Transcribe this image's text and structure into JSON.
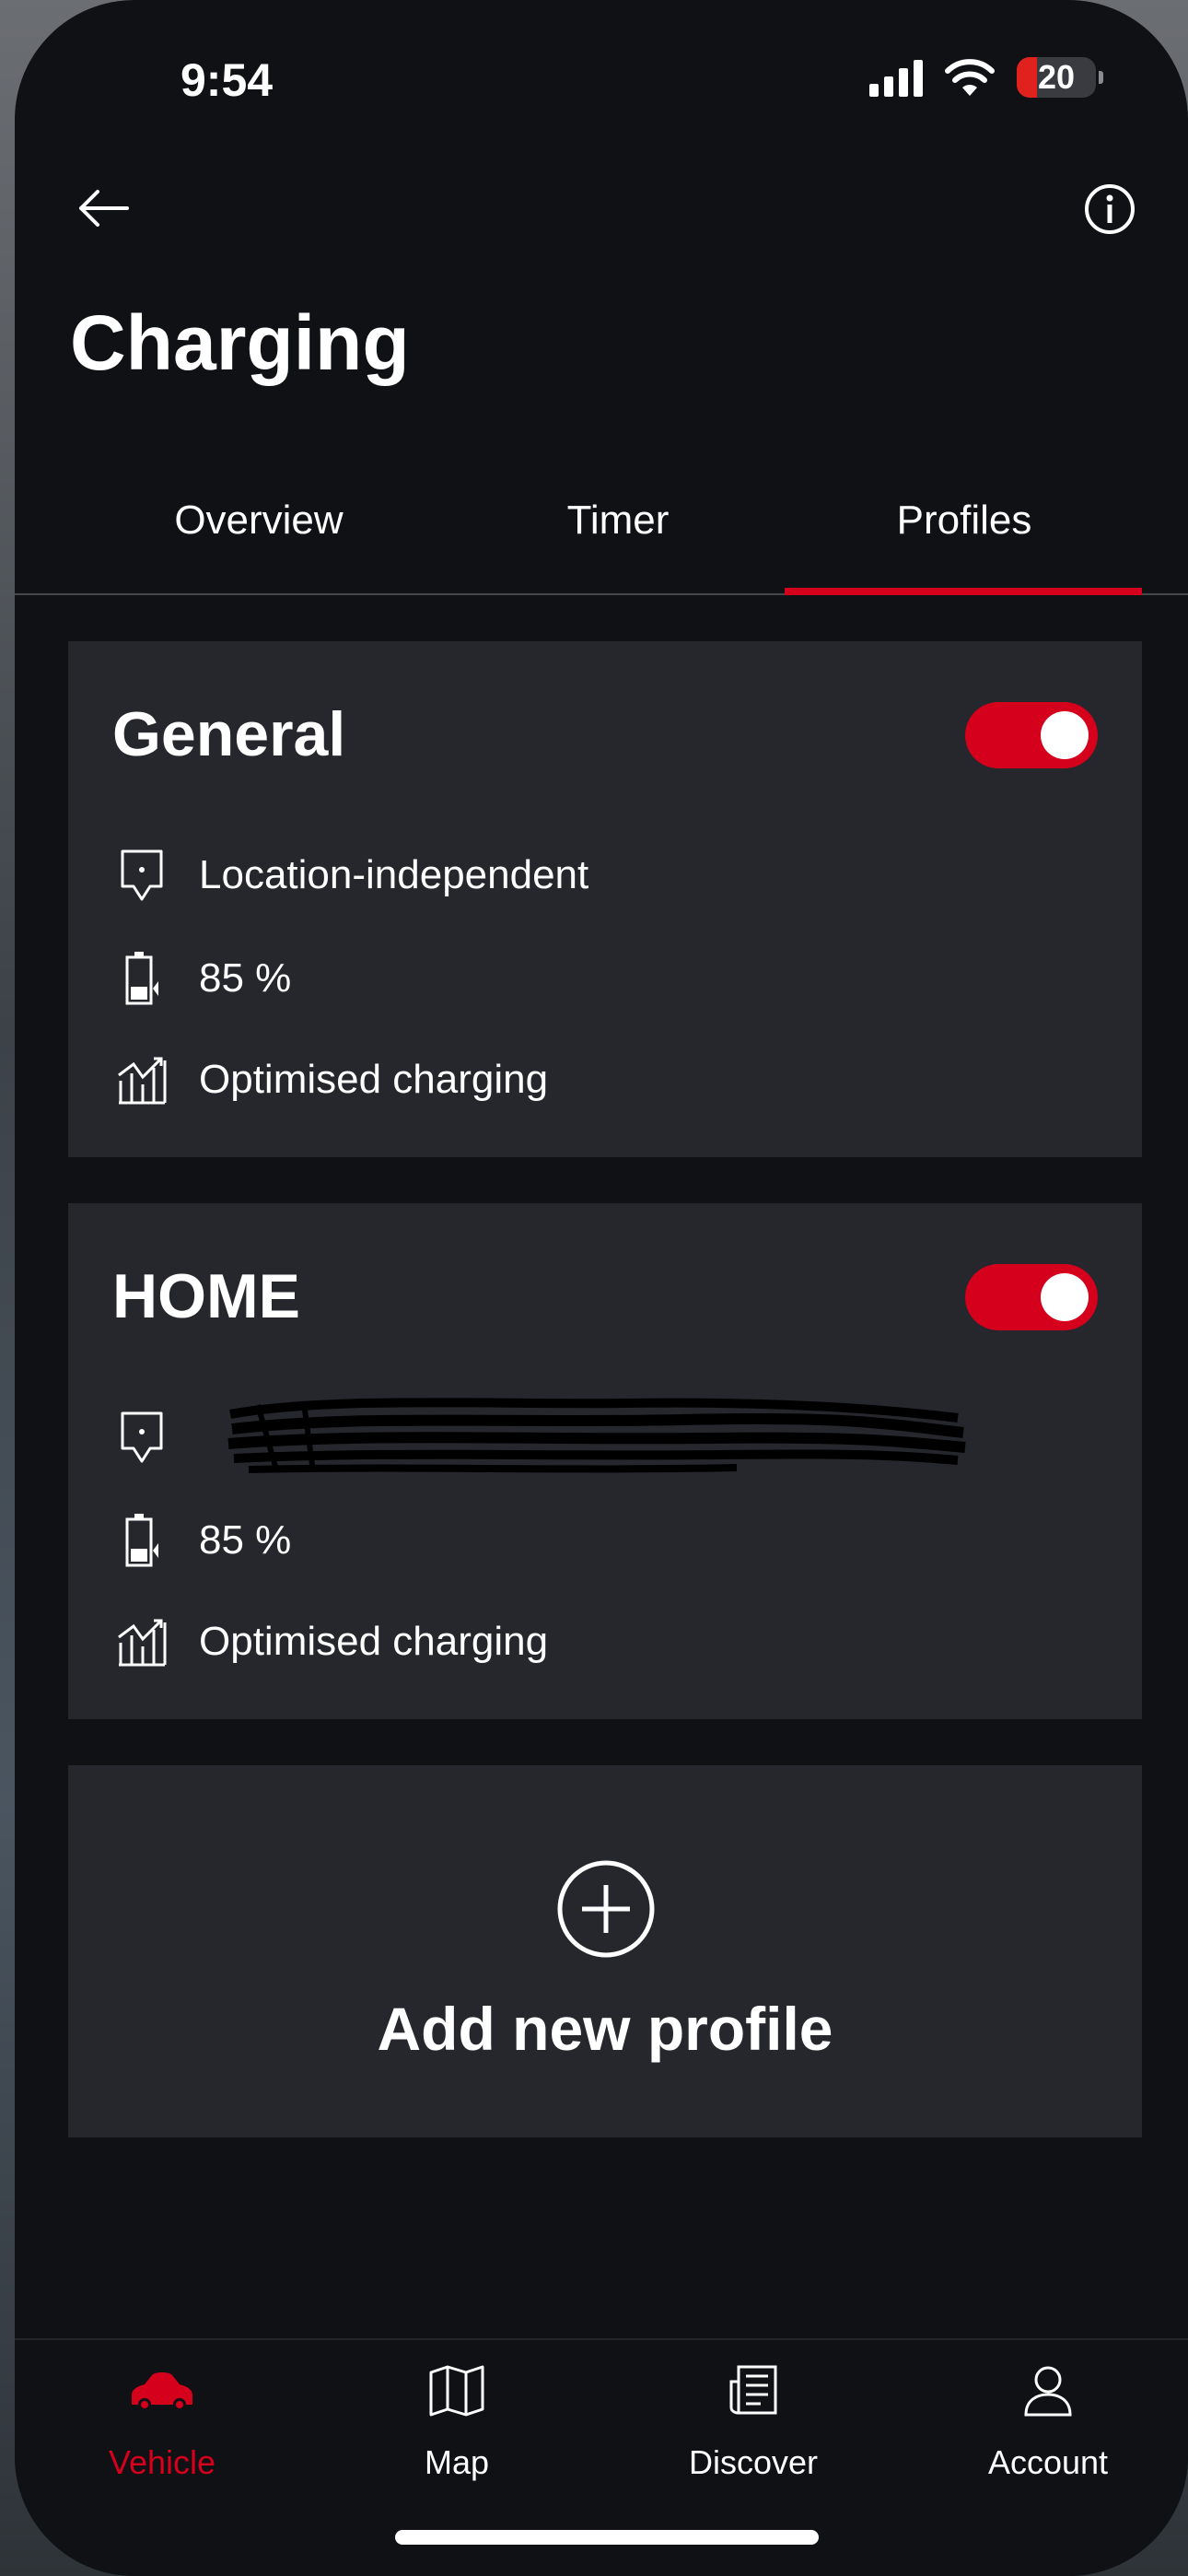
{
  "status_bar": {
    "time": "9:54",
    "battery_level": "20"
  },
  "header": {
    "title": "Charging"
  },
  "tabs": [
    {
      "label": "Overview",
      "active": false
    },
    {
      "label": "Timer",
      "active": false
    },
    {
      "label": "Profiles",
      "active": true
    }
  ],
  "profiles": [
    {
      "name": "General",
      "enabled": true,
      "location": "Location-independent",
      "target_charge": "85 %",
      "mode": "Optimised charging"
    },
    {
      "name": "HOME",
      "enabled": true,
      "location": "",
      "target_charge": "85 %",
      "mode": "Optimised charging"
    }
  ],
  "add_profile": {
    "label": "Add new profile"
  },
  "bottom_nav": [
    {
      "label": "Vehicle",
      "icon": "car-icon",
      "active": true
    },
    {
      "label": "Map",
      "icon": "map-icon",
      "active": false
    },
    {
      "label": "Discover",
      "icon": "newspaper-icon",
      "active": false
    },
    {
      "label": "Account",
      "icon": "user-icon",
      "active": false
    }
  ],
  "colors": {
    "accent": "#d5001c",
    "background": "#0f1115",
    "card": "#25272d"
  }
}
